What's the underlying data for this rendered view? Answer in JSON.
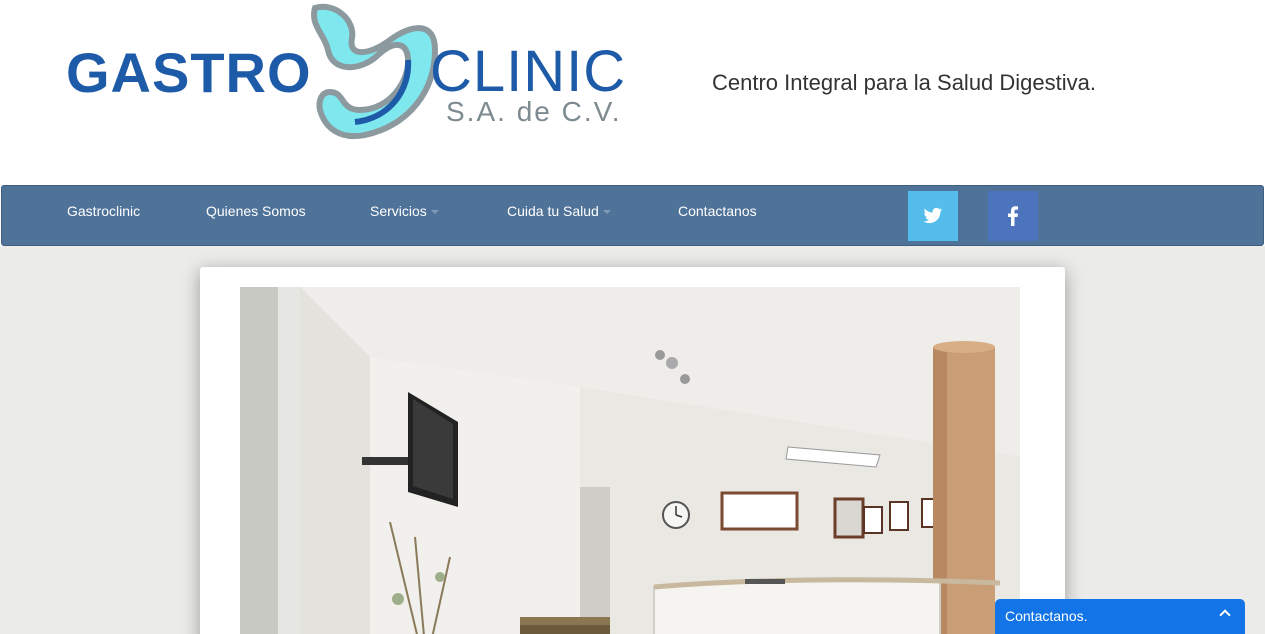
{
  "header": {
    "logo": {
      "gastro": "GASTRO",
      "clinic": "CLINIC",
      "sa": "S.A. de C.V."
    },
    "tagline": "Centro Integral para la Salud Digestiva."
  },
  "nav": {
    "items": [
      {
        "label": "Gastroclinic",
        "has_dropdown": false
      },
      {
        "label": "Quienes Somos",
        "has_dropdown": false
      },
      {
        "label": "Servicios",
        "has_dropdown": true
      },
      {
        "label": "Cuida tu Salud",
        "has_dropdown": true
      },
      {
        "label": "Contactanos",
        "has_dropdown": false
      }
    ],
    "social": [
      {
        "icon": "twitter-icon",
        "color": "#55bdec"
      },
      {
        "icon": "facebook-icon",
        "color": "#4b74bc"
      }
    ],
    "background": "#4f7299"
  },
  "contact_widget": {
    "label": "Contactanos.",
    "color": "#1274e6"
  }
}
